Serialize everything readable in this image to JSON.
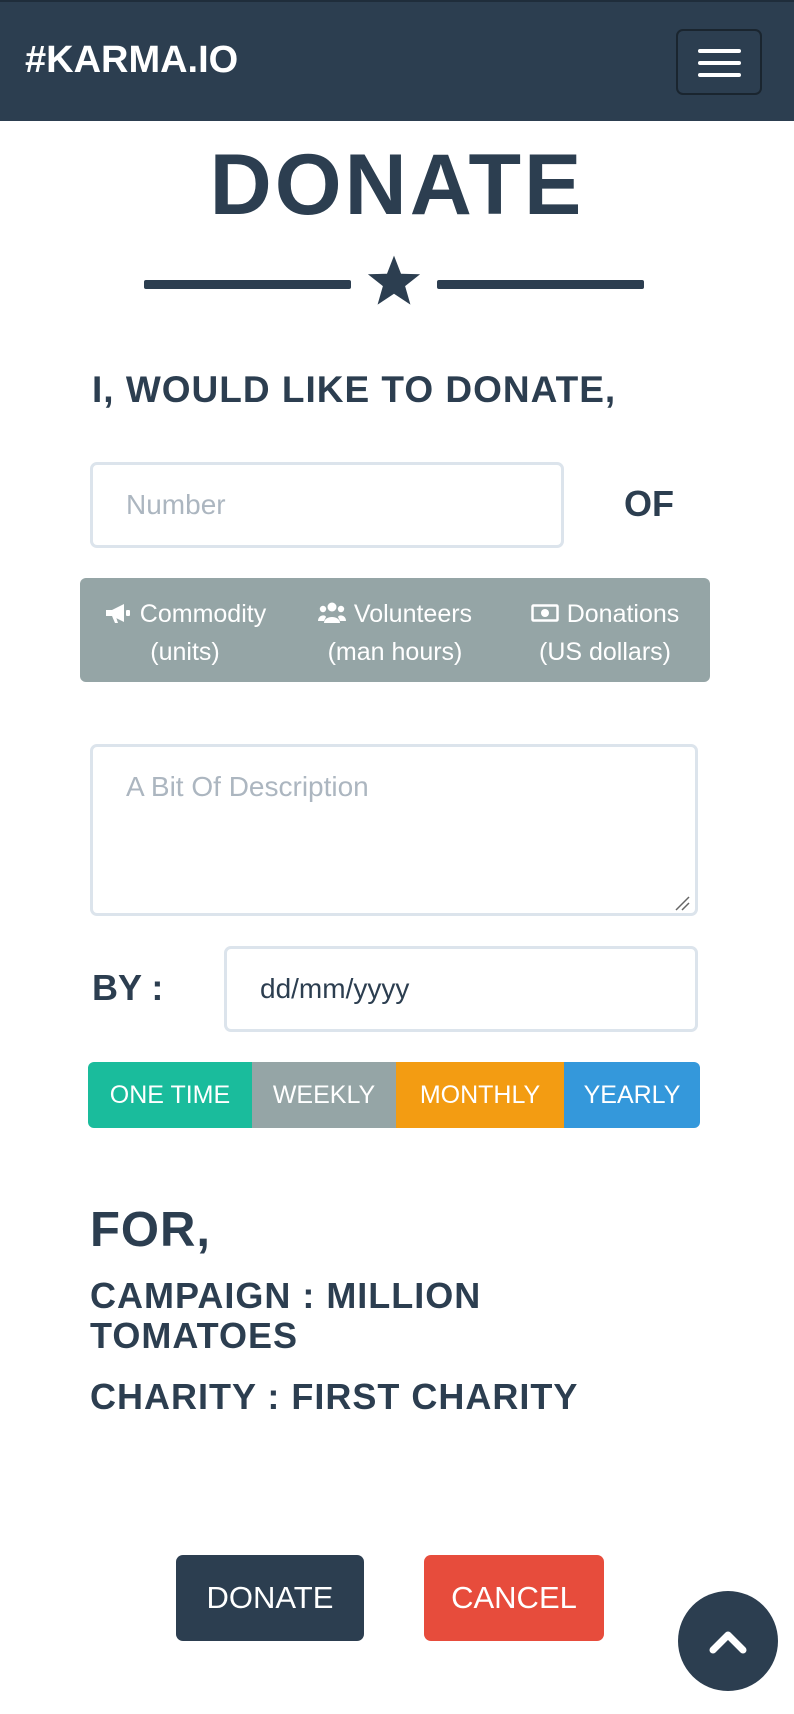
{
  "navbar": {
    "brand": "#KARMA.IO",
    "bg_color": "#2c3e50"
  },
  "page": {
    "heading": "DONATE",
    "intro": "I, WOULD LIKE TO DONATE,"
  },
  "quantity": {
    "placeholder": "Number",
    "of_label": "OF"
  },
  "unit_options": [
    {
      "icon": "megaphone-icon",
      "label": "Commodity",
      "sub": "(units)"
    },
    {
      "icon": "users-icon",
      "label": "Volunteers",
      "sub": "(man hours)"
    },
    {
      "icon": "money-icon",
      "label": "Donations",
      "sub": "(US dollars)"
    }
  ],
  "description": {
    "placeholder": "A Bit Of Description"
  },
  "date": {
    "label": "BY :",
    "value": "dd/mm/yyyy"
  },
  "frequency": {
    "options": [
      {
        "label": "ONE TIME",
        "color": "#1abc9c"
      },
      {
        "label": "WEEKLY",
        "color": "#95a5a6"
      },
      {
        "label": "MONTHLY",
        "color": "#f39c12"
      },
      {
        "label": "YEARLY",
        "color": "#3498db"
      }
    ]
  },
  "target": {
    "for_label": "FOR,",
    "campaign": "CAMPAIGN : MILLION TOMATOES",
    "charity": "CHARITY : FIRST CHARITY"
  },
  "actions": {
    "donate_label": "DONATE",
    "cancel_label": "CANCEL",
    "donate_color": "#2c3e50",
    "cancel_color": "#e74c3c"
  },
  "scroll_top": {
    "icon": "chevron-up-icon"
  }
}
